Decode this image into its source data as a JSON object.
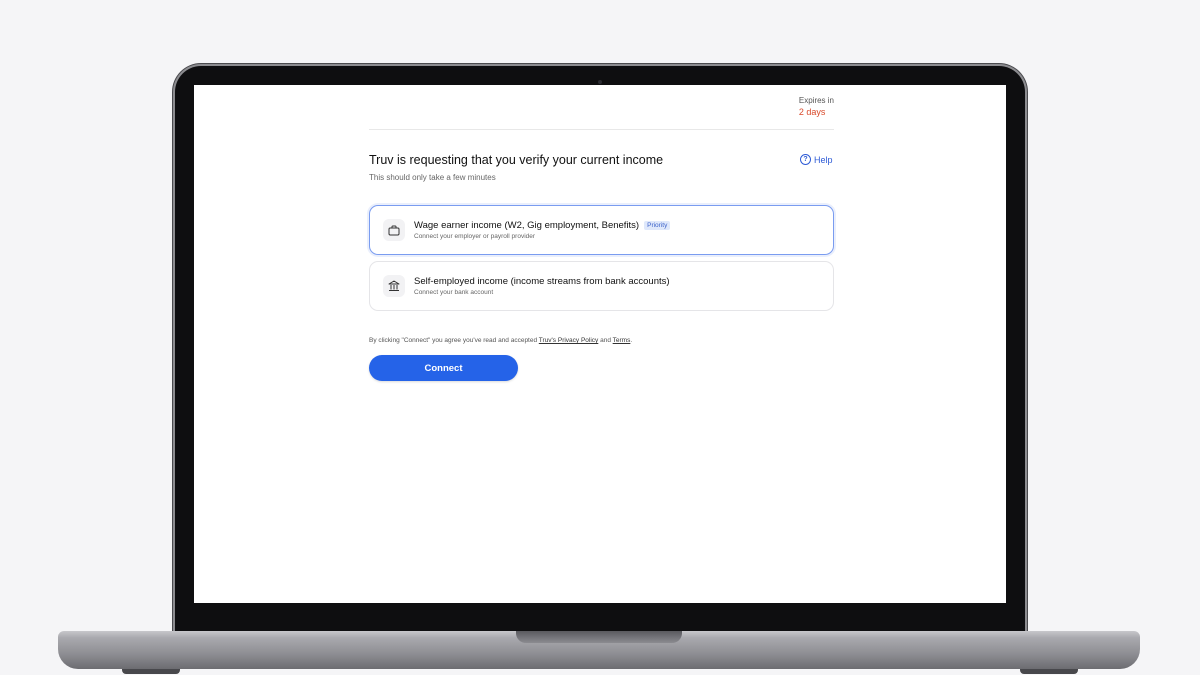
{
  "header": {
    "expires_label": "Expires in",
    "expires_value": "2 days"
  },
  "main": {
    "title": "Truv is requesting that you verify your current income",
    "subtitle": "This should only take a few minutes",
    "help_label": "Help"
  },
  "options": [
    {
      "title": "Wage earner income (W2, Gig employment, Benefits)",
      "badge": "Priority",
      "description": "Connect your employer or payroll provider",
      "icon": "briefcase-icon",
      "selected": true
    },
    {
      "title": "Self-employed income (income streams from bank accounts)",
      "description": "Connect your bank account",
      "icon": "bank-icon",
      "selected": false
    }
  ],
  "consent": {
    "prefix": "By clicking \"Connect\" you agree you've read and accepted ",
    "privacy_link": "Truv's Privacy Policy",
    "and": " and ",
    "terms_link": "Terms",
    "suffix": "."
  },
  "connect_button": "Connect",
  "colors": {
    "accent": "#2563e8",
    "expires": "#d94a2b",
    "badge_bg": "#dfe8fb"
  }
}
